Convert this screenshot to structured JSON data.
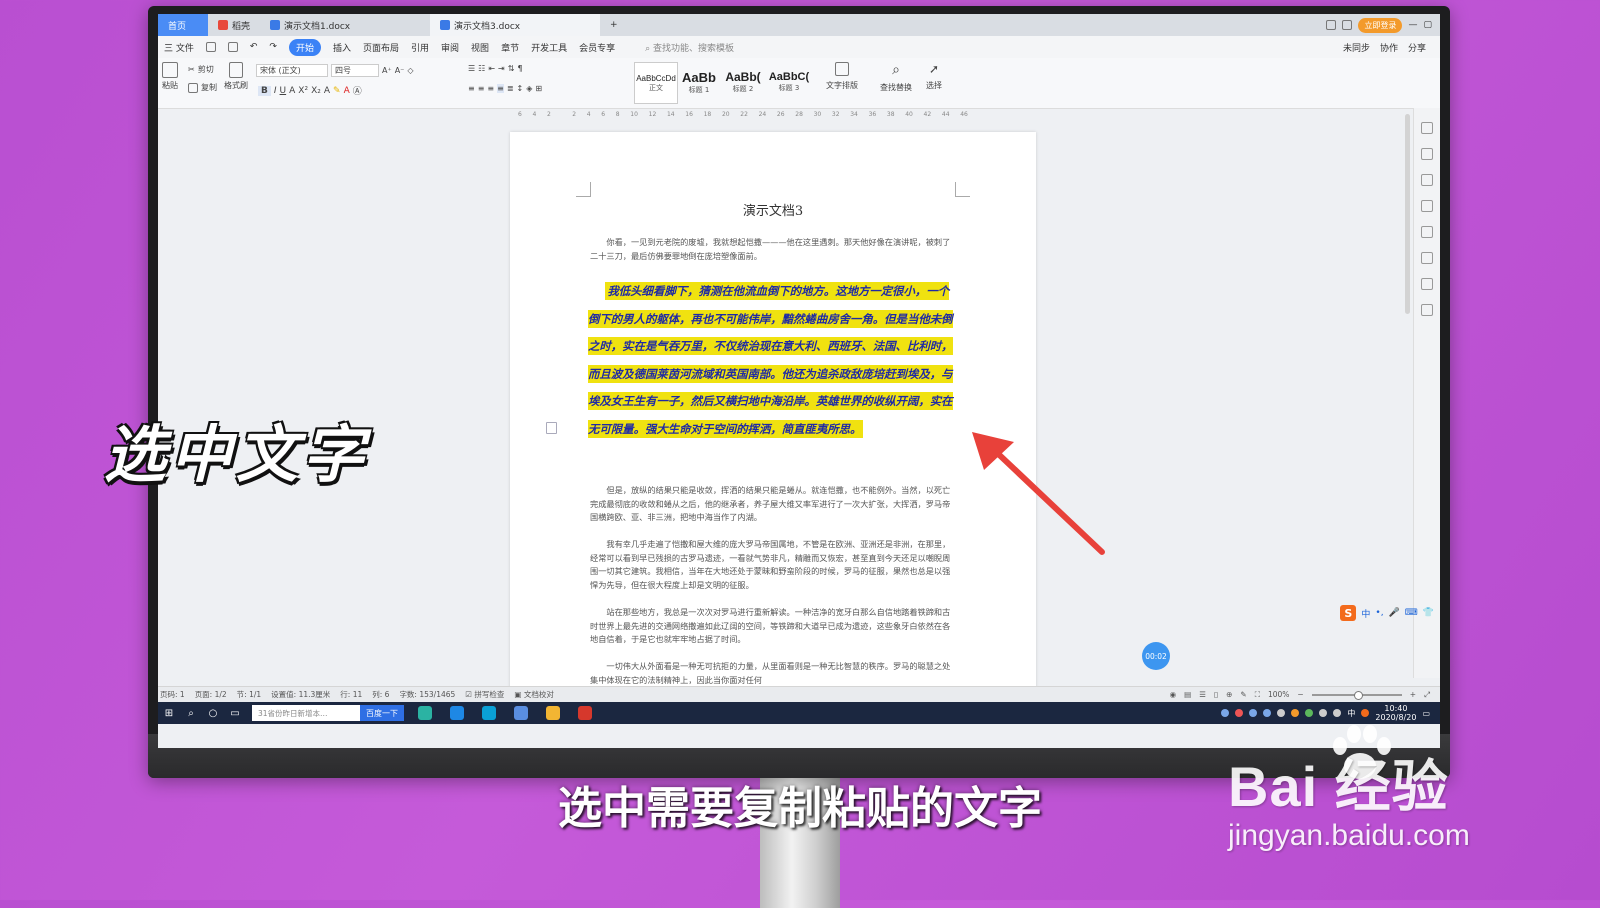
{
  "window": {
    "tabs": [
      {
        "label": "首页"
      },
      {
        "label": "稻壳"
      },
      {
        "label": "演示文档1.docx"
      },
      {
        "label": "演示文档3.docx"
      }
    ],
    "new_tab": "+",
    "upgrade_badge": "立即登录"
  },
  "menu": {
    "file": "三 文件",
    "items": [
      "开始",
      "插入",
      "页面布局",
      "引用",
      "审阅",
      "视图",
      "章节",
      "开发工具",
      "会员专享"
    ],
    "active": "开始",
    "search_placeholder": "查找功能、搜索模板",
    "right_items": [
      "未同步",
      "协作",
      "分享"
    ]
  },
  "ribbon": {
    "paste": "粘贴",
    "cut": "剪切",
    "copy": "复制",
    "format_painter": "格式刷",
    "font_name": "宋体 (正文)",
    "font_size": "四号",
    "styles": [
      {
        "preview": "AaBbCcDd",
        "label": "正文"
      },
      {
        "preview": "AaBb",
        "label": "标题 1"
      },
      {
        "preview": "AaBb(",
        "label": "标题 2"
      },
      {
        "preview": "AaBbC(",
        "label": "标题 3"
      }
    ],
    "text_layout": "文字排版",
    "find_replace": "查找替换",
    "select": "选择"
  },
  "ruler": {
    "ticks": [
      "6",
      "4",
      "2",
      "",
      "2",
      "4",
      "6",
      "8",
      "10",
      "12",
      "14",
      "16",
      "18",
      "20",
      "22",
      "24",
      "26",
      "28",
      "30",
      "32",
      "34",
      "36",
      "38",
      "40",
      "42",
      "44",
      "46"
    ]
  },
  "document": {
    "title": "演示文档3",
    "para1": "你看，一见到元老院的废墟，我就想起恺撒———他在这里遇刺。那天他好像在演讲呢，被刺了二十三刀，最后仿佛要罪地倒在庞培塑像面前。",
    "selected_para": "我低头细看脚下，猜测在他流血倒下的地方。这地方一定很小，一个倒下的男人的躯体，再也不可能伟岸，黯然蜷曲房舍一角。但是当他未倒之时，实在是气吞万里，不仅统治现在意大利、西班牙、法国、比利时，而且波及德国莱茵河流域和英国南部。他还为追杀政敌庞培赶到埃及，与埃及女王生有一子，然后又横扫地中海沿岸。英雄世界的收纵开阔，实在无可限量。强大生命对于空间的挥洒，简直匪夷所思。",
    "para3": "但是，放纵的结果只能是收敛，挥洒的结果只能是蜷从。就连恺撒，也不能例外。当然，以死亡完成最彻底的收敛和蜷从之后，他的继承者，养子屋大维又率军进行了一次大扩张，大挥洒，罗马帝国横跨欧、亚、非三洲，把地中海当作了内湖。",
    "para4": "我有幸几乎走遍了恺撒和屋大维的庞大罗马帝国属地，不管是在欧洲、亚洲还是非洲，在那里，经常可以看到早已残损的古罗马遗迹，一看就气势非凡，精雕而又恢宏，甚至直到今天还足以嘲睨周围一切其它建筑。我相信，当年在大地还处于蒙昧和野蛮阶段的时候，罗马的征服，果然也总是以强悍为先导，但在很大程度上却是文明的征服。",
    "para5": "站在那些地方，我总是一次次对罗马进行重新解读。一种洁净的宽牙白那么自信地踏着铁蹄和古时世界上最先进的交通网络撒遍如此辽阔的空间，等铁蹄和大道早已成为遗迹，这些象牙白依然在各地自信着，于是它也就牢牢地占据了时间。",
    "para6": "一切伟大从外面看是一种无可抗拒的力量，从里面看则是一种无比智慧的秩序。罗马的聪慧之处集中体现在它的法制精神上，因此当你面对任何"
  },
  "ime": {
    "logo": "S",
    "mode": "中"
  },
  "timer": "00:02",
  "status": {
    "page_num": "页码: 1",
    "pages": "页面: 1/2",
    "section": "节: 1/1",
    "settings": "设置值: 11.3厘米",
    "line": "行: 11",
    "column": "列: 6",
    "words": "字数: 153/1465",
    "spell": "拼写检查",
    "proof": "文档校对",
    "zoom": "100%"
  },
  "taskbar": {
    "search_placeholder": "31省份昨日新增本…",
    "search_button": "百度一下",
    "ime_indicator": "中",
    "time": "10:40",
    "date": "2020/8/20"
  },
  "overlay": {
    "big_caption": "选中文字",
    "subtitle": "选中需要复制粘贴的文字"
  },
  "watermark": {
    "logo": "Bai 经验",
    "url": "jingyan.baidu.com"
  },
  "colors": {
    "background": "#c055d6",
    "highlight": "#f0e210",
    "selected_text": "#1f2aa5",
    "arrow": "#e8413a",
    "accent": "#3b82f6"
  }
}
